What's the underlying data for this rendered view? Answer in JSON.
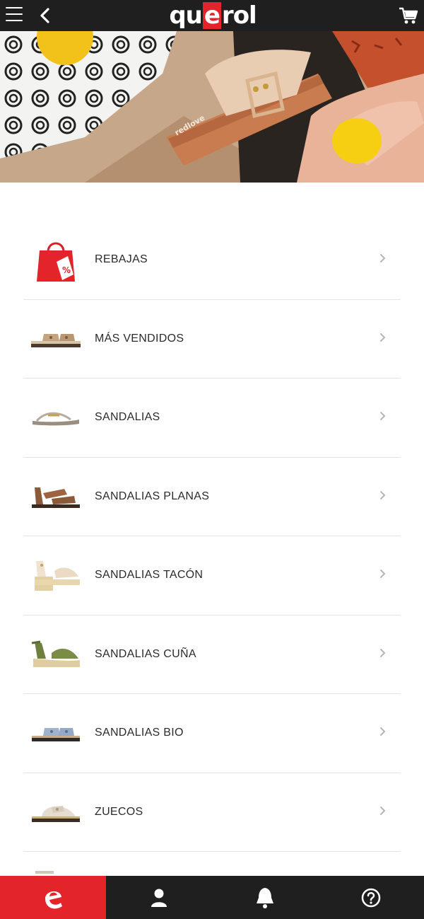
{
  "header": {
    "logo": {
      "before": "qu",
      "highlight": "e",
      "after": "rol"
    },
    "menu_icon": "hamburger-icon",
    "back_icon": "chevron-left-icon",
    "cart_icon": "cart-icon"
  },
  "hero": {
    "image": "sandals-lemons-banner"
  },
  "categories": [
    {
      "label": "REBAJAS",
      "icon": "sale-bag-icon"
    },
    {
      "label": "MÁS VENDIDOS",
      "icon": "bestseller-sandal-image"
    },
    {
      "label": "SANDALIAS",
      "icon": "sandal-image"
    },
    {
      "label": "SANDALIAS PLANAS",
      "icon": "flat-sandal-image"
    },
    {
      "label": "SANDALIAS TACÓN",
      "icon": "heel-sandal-image"
    },
    {
      "label": "SANDALIAS CUÑA",
      "icon": "wedge-sandal-image"
    },
    {
      "label": "SANDALIAS BIO",
      "icon": "bio-sandal-image"
    },
    {
      "label": "ZUECOS",
      "icon": "clog-image"
    }
  ],
  "bottom_nav": [
    {
      "name": "home",
      "icon": "querol-e-icon",
      "active": true
    },
    {
      "name": "account",
      "icon": "user-icon",
      "active": false
    },
    {
      "name": "notifications",
      "icon": "bell-icon",
      "active": false
    },
    {
      "name": "help",
      "icon": "help-icon",
      "active": false
    }
  ],
  "colors": {
    "brand_red": "#e3242b",
    "bar_dark": "#1f1f1f",
    "text": "#2b2b2b",
    "divider": "#e4e4e4"
  }
}
